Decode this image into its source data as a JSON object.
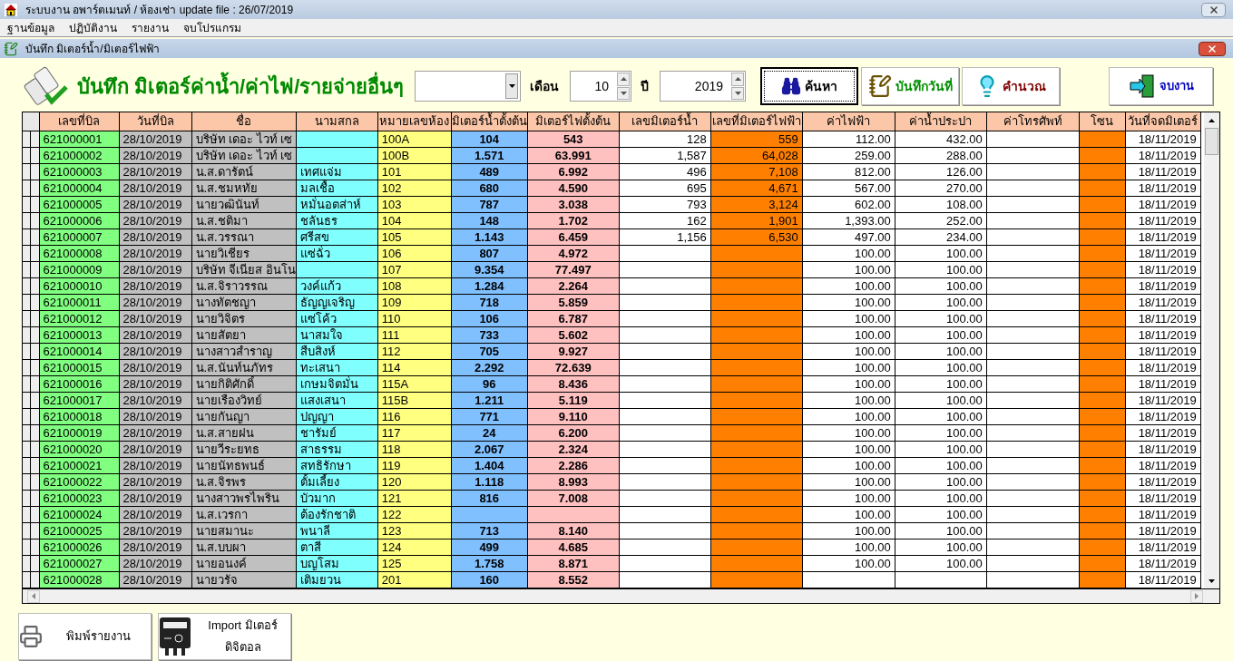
{
  "window": {
    "title": "ระบบงาน อพาร์ตเมนท์ / ห้องเช่า update file : 26/07/2019"
  },
  "menu": [
    "ฐานข้อมูล",
    "ปฏิบัติงาน",
    "รายงาน",
    "จบโปรแกรม"
  ],
  "child_window": {
    "title": "บันทึก มิเตอร์น้ำ/มิเตอร์ไฟฟ้า"
  },
  "header": {
    "title": "บันทึก มิเตอร์ค่าน้ำ/ค่าไฟ/รายจ่ายอื่นๆ",
    "month_label": "เดือน",
    "month_value": "10",
    "year_label": "ปี",
    "year_value": "2019"
  },
  "toolbar_buttons": [
    {
      "label": "ค้นหา",
      "kind": "search",
      "focused": true
    },
    {
      "label": "บันทึกวันที่",
      "kind": "save",
      "focused": false
    },
    {
      "label": "คำนวณ",
      "kind": "calc",
      "focused": false
    }
  ],
  "exit_button": {
    "label": "จบงาน"
  },
  "table": {
    "columns": [
      {
        "label": "เลขที่บิล",
        "kind": "text",
        "color": "#80ff80"
      },
      {
        "label": "วันที่บิล",
        "kind": "text",
        "color": "#c0c0c0"
      },
      {
        "label": "ชื่อ",
        "kind": "text",
        "color": "#c0c0c0"
      },
      {
        "label": "นามสกล",
        "kind": "text",
        "color": "#80ffff"
      },
      {
        "label": "หมายเลขห้อง",
        "kind": "text",
        "color": "#ffff80"
      },
      {
        "label": "มิเตอร์น้ำตั้งต้น",
        "kind": "reading",
        "color": "#80c0ff"
      },
      {
        "label": "มิเตอร์ไฟตั้งต้น",
        "kind": "reading",
        "color": "#ffc0c0"
      },
      {
        "label": "เลขมิเตอร์น้ำ",
        "kind": "number",
        "color": "#ffffff"
      },
      {
        "label": "เลขที่มิเตอร์ไฟฟ้า",
        "kind": "number",
        "color": "#ff8000"
      },
      {
        "label": "ค่าไฟฟ้า",
        "kind": "number",
        "color": "#ffffff"
      },
      {
        "label": "ค่าน้ำประปา",
        "kind": "number",
        "color": "#ffffff"
      },
      {
        "label": "ค่าโทรศัพท์",
        "kind": "number",
        "color": "#ffffff"
      },
      {
        "label": "โซน",
        "kind": "text",
        "color": "#ff8000"
      },
      {
        "label": "วันที่จดมิเตอร์",
        "kind": "number",
        "color": "#ffffff"
      }
    ],
    "rows": [
      [
        "621000001",
        "28/10/2019",
        "บริษัท เดอะ ไวท์ เซ",
        null,
        "100A",
        "104",
        "543",
        "128",
        "559",
        "112.00",
        "432.00",
        null,
        null,
        "18/11/2019"
      ],
      [
        "621000002",
        "28/10/2019",
        "บริษัท เดอะ ไวท์ เซ",
        null,
        "100B",
        "1.571",
        "63.991",
        "1,587",
        "64,028",
        "259.00",
        "288.00",
        null,
        null,
        "18/11/2019"
      ],
      [
        "621000003",
        "28/10/2019",
        "น.ส.ดารัตน์",
        "เทศแจ่ม",
        "101",
        "489",
        "6.992",
        "496",
        "7,108",
        "812.00",
        "126.00",
        null,
        null,
        "18/11/2019"
      ],
      [
        "621000004",
        "28/10/2019",
        "น.ส.ชมหทัย",
        "มลเชื้อ",
        "102",
        "680",
        "4.590",
        "695",
        "4,671",
        "567.00",
        "270.00",
        null,
        null,
        "18/11/2019"
      ],
      [
        "621000005",
        "28/10/2019",
        "นายวฒินันท์",
        "หมั่นอตส่าห์",
        "103",
        "787",
        "3.038",
        "793",
        "3,124",
        "602.00",
        "108.00",
        null,
        null,
        "18/11/2019"
      ],
      [
        "621000006",
        "28/10/2019",
        "น.ส.ชติมา",
        "ชลันธร",
        "104",
        "148",
        "1.702",
        "162",
        "1,901",
        "1,393.00",
        "252.00",
        null,
        null,
        "18/11/2019"
      ],
      [
        "621000007",
        "28/10/2019",
        "น.ส.วรรณา",
        "ศรีสข",
        "105",
        "1.143",
        "6.459",
        "1,156",
        "6,530",
        "497.00",
        "234.00",
        null,
        null,
        "18/11/2019"
      ],
      [
        "621000008",
        "28/10/2019",
        "นายวิเชียร",
        "แซ่ฉั่ว",
        "106",
        "807",
        "4.972",
        null,
        null,
        "100.00",
        "100.00",
        null,
        null,
        "18/11/2019"
      ],
      [
        "621000009",
        "28/10/2019",
        "บริษัท จีเนียส อินโน",
        null,
        "107",
        "9.354",
        "77.497",
        null,
        null,
        "100.00",
        "100.00",
        null,
        null,
        "18/11/2019"
      ],
      [
        "621000010",
        "28/10/2019",
        "น.ส.จิราวรรณ",
        "วงค์แก้ว",
        "108",
        "1.284",
        "2.264",
        null,
        null,
        "100.00",
        "100.00",
        null,
        null,
        "18/11/2019"
      ],
      [
        "621000011",
        "28/10/2019",
        "นางทัตชญา",
        "ธัญญเจริญ",
        "109",
        "718",
        "5.859",
        null,
        null,
        "100.00",
        "100.00",
        null,
        null,
        "18/11/2019"
      ],
      [
        "621000012",
        "28/10/2019",
        "นายวิจิตร",
        "แซ่โค้ว",
        "110",
        "106",
        "6.787",
        null,
        null,
        "100.00",
        "100.00",
        null,
        null,
        "18/11/2019"
      ],
      [
        "621000013",
        "28/10/2019",
        "นายสัตยา",
        "นาสมใจ",
        "111",
        "733",
        "5.602",
        null,
        null,
        "100.00",
        "100.00",
        null,
        null,
        "18/11/2019"
      ],
      [
        "621000014",
        "28/10/2019",
        "นางสาวสำราญ",
        "สืบสิงห์",
        "112",
        "705",
        "9.927",
        null,
        null,
        "100.00",
        "100.00",
        null,
        null,
        "18/11/2019"
      ],
      [
        "621000015",
        "28/10/2019",
        "น.ส.นันท์นภัทร",
        "ทะเสนา",
        "114",
        "2.292",
        "72.639",
        null,
        null,
        "100.00",
        "100.00",
        null,
        null,
        "18/11/2019"
      ],
      [
        "621000016",
        "28/10/2019",
        "นายกิติศักดิ์",
        "เกษมจิตมั่น",
        "115A",
        "96",
        "8.436",
        null,
        null,
        "100.00",
        "100.00",
        null,
        null,
        "18/11/2019"
      ],
      [
        "621000017",
        "28/10/2019",
        "นายเรืองวิทย์",
        "แสงเสนา",
        "115B",
        "1.211",
        "5.119",
        null,
        null,
        "100.00",
        "100.00",
        null,
        null,
        "18/11/2019"
      ],
      [
        "621000018",
        "28/10/2019",
        "นายกันญา",
        "ปญญา",
        "116",
        "771",
        "9.110",
        null,
        null,
        "100.00",
        "100.00",
        null,
        null,
        "18/11/2019"
      ],
      [
        "621000019",
        "28/10/2019",
        "น.ส.สายฝน",
        "ชารัมย์",
        "117",
        "24",
        "6.200",
        null,
        null,
        "100.00",
        "100.00",
        null,
        null,
        "18/11/2019"
      ],
      [
        "621000020",
        "28/10/2019",
        "นายวีระยทธ",
        "สาธรรม",
        "118",
        "2.067",
        "2.324",
        null,
        null,
        "100.00",
        "100.00",
        null,
        null,
        "18/11/2019"
      ],
      [
        "621000021",
        "28/10/2019",
        "นายนัทธพนธ์",
        "สทธิรักษา",
        "119",
        "1.404",
        "2.286",
        null,
        null,
        "100.00",
        "100.00",
        null,
        null,
        "18/11/2019"
      ],
      [
        "621000022",
        "28/10/2019",
        "น.ส.จิรพร",
        "ตั้มเลี้ยง",
        "120",
        "1.118",
        "8.993",
        null,
        null,
        "100.00",
        "100.00",
        null,
        null,
        "18/11/2019"
      ],
      [
        "621000023",
        "28/10/2019",
        "นางสาวพรไพริน",
        "บัวมาก",
        "121",
        "816",
        "7.008",
        null,
        null,
        "100.00",
        "100.00",
        null,
        null,
        "18/11/2019"
      ],
      [
        "621000024",
        "28/10/2019",
        "น.ส.เวรกา",
        "ต้องรักชาติ",
        "122",
        null,
        null,
        null,
        null,
        "100.00",
        "100.00",
        null,
        null,
        "18/11/2019"
      ],
      [
        "621000025",
        "28/10/2019",
        "นายสมานะ",
        "พนาลี",
        "123",
        "713",
        "8.140",
        null,
        null,
        "100.00",
        "100.00",
        null,
        null,
        "18/11/2019"
      ],
      [
        "621000026",
        "28/10/2019",
        "น.ส.บบผา",
        "ตาสี",
        "124",
        "499",
        "4.685",
        null,
        null,
        "100.00",
        "100.00",
        null,
        null,
        "18/11/2019"
      ],
      [
        "621000027",
        "28/10/2019",
        "นายอนงค์",
        "บญโสม",
        "125",
        "1.758",
        "8.871",
        null,
        null,
        "100.00",
        "100.00",
        null,
        null,
        "18/11/2019"
      ],
      [
        "621000028",
        "28/10/2019",
        "นายวรัจ",
        "เติมยวน",
        "201",
        "160",
        "8.552",
        null,
        null,
        null,
        null,
        null,
        null,
        "18/11/2019"
      ]
    ]
  },
  "bottom_buttons": [
    {
      "kind": "print",
      "lines": [
        "พิมพ์รายงาน"
      ]
    },
    {
      "kind": "meter",
      "lines": [
        "Import มิเตอร์",
        "ดิจิตอล"
      ]
    }
  ]
}
